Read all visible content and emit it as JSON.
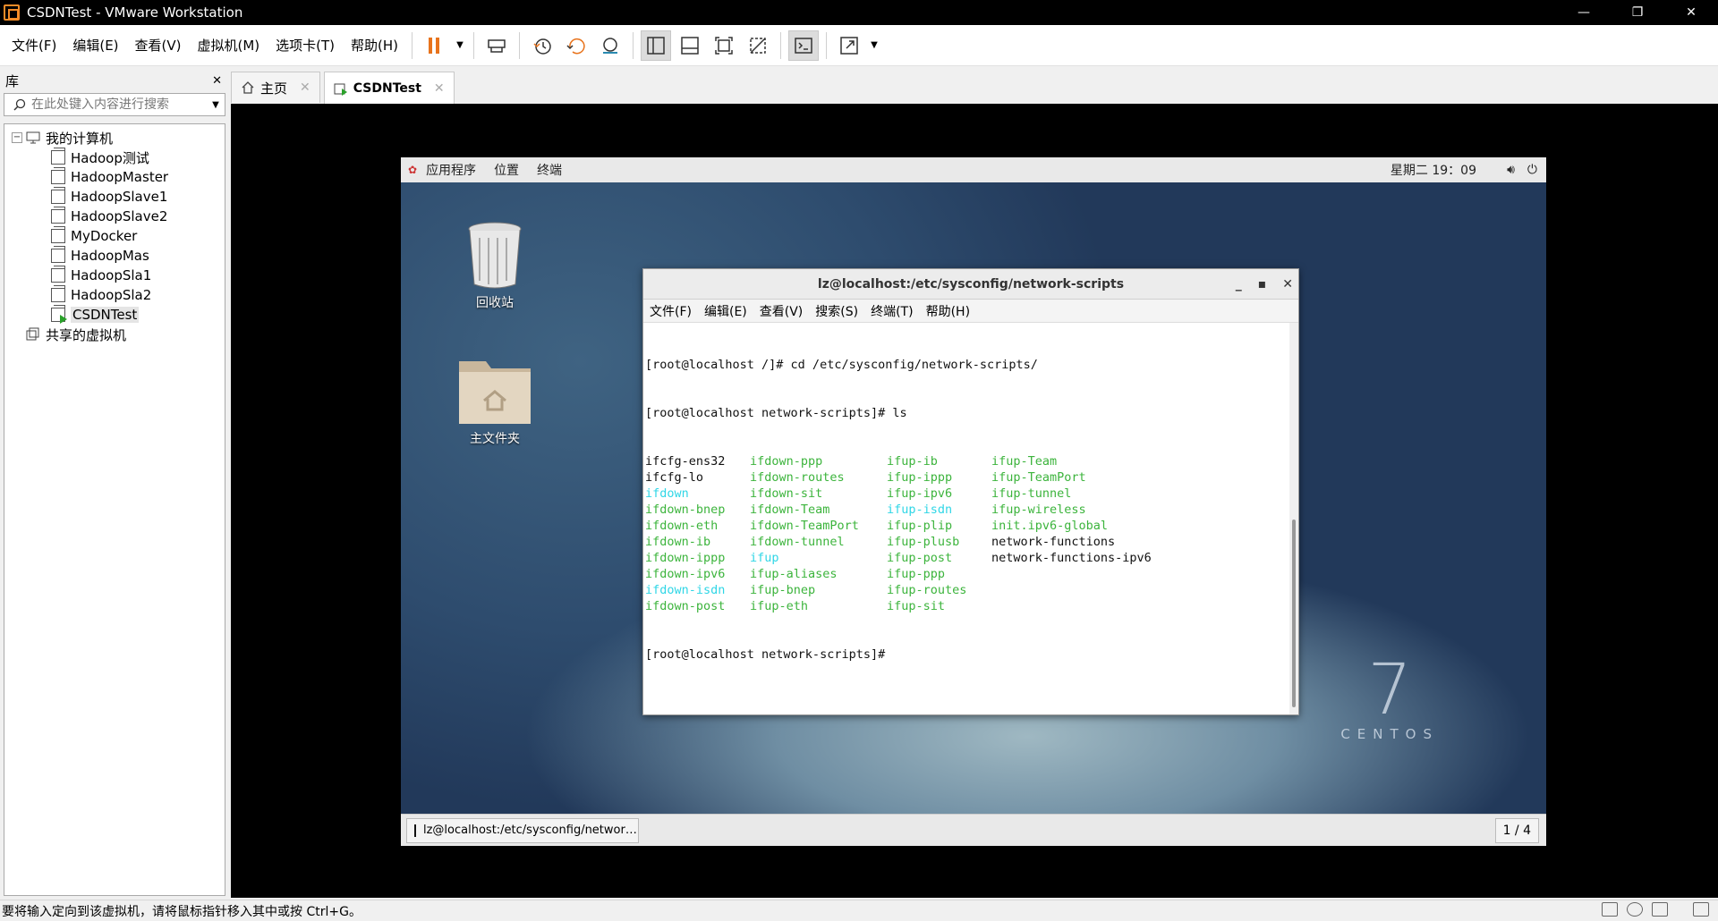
{
  "window": {
    "title": "CSDNTest - VMware Workstation",
    "minimize": "—",
    "restore": "❐",
    "close": "✕"
  },
  "menu": [
    "文件(F)",
    "编辑(E)",
    "查看(V)",
    "虚拟机(M)",
    "选项卡(T)",
    "帮助(H)"
  ],
  "library": {
    "title": "库",
    "close": "✕",
    "search_placeholder": "在此处键入内容进行搜索",
    "root": "我的计算机",
    "vms": [
      "Hadoop测试",
      "HadoopMaster",
      "HadoopSlave1",
      "HadoopSlave2",
      "MyDocker",
      "HadoopMas",
      "HadoopSla1",
      "HadoopSla2",
      "CSDNTest"
    ],
    "shared": "共享的虚拟机"
  },
  "tabs": [
    {
      "label": "主页",
      "close": "✕"
    },
    {
      "label": "CSDNTest",
      "close": "✕"
    }
  ],
  "guest": {
    "top_menu": [
      "应用程序",
      "位置",
      "终端"
    ],
    "clock": "星期二 19：09",
    "desktop_icons": [
      "回收站",
      "主文件夹"
    ],
    "logo_number": "7",
    "logo_word": "CENTOS",
    "task_label": "lz@localhost:/etc/sysconfig/networ…",
    "pager": "1 / 4"
  },
  "terminal": {
    "title": "lz@localhost:/etc/sysconfig/network-scripts",
    "menu": [
      "文件(F)",
      "编辑(E)",
      "查看(V)",
      "搜索(S)",
      "终端(T)",
      "帮助(H)"
    ],
    "line1": "[root@localhost /]# cd /etc/sysconfig/network-scripts/",
    "line2": "[root@localhost network-scripts]# ls",
    "ls_rows": [
      [
        {
          "t": "ifcfg-ens32",
          "c": "plain"
        },
        {
          "t": "ifdown-ppp",
          "c": "green"
        },
        {
          "t": "ifup-ib",
          "c": "green"
        },
        {
          "t": "ifup-Team",
          "c": "green"
        }
      ],
      [
        {
          "t": "ifcfg-lo",
          "c": "plain"
        },
        {
          "t": "ifdown-routes",
          "c": "green"
        },
        {
          "t": "ifup-ippp",
          "c": "green"
        },
        {
          "t": "ifup-TeamPort",
          "c": "green"
        }
      ],
      [
        {
          "t": "ifdown",
          "c": "cyan"
        },
        {
          "t": "ifdown-sit",
          "c": "green"
        },
        {
          "t": "ifup-ipv6",
          "c": "green"
        },
        {
          "t": "ifup-tunnel",
          "c": "green"
        }
      ],
      [
        {
          "t": "ifdown-bnep",
          "c": "green"
        },
        {
          "t": "ifdown-Team",
          "c": "green"
        },
        {
          "t": "ifup-isdn",
          "c": "cyan"
        },
        {
          "t": "ifup-wireless",
          "c": "green"
        }
      ],
      [
        {
          "t": "ifdown-eth",
          "c": "green"
        },
        {
          "t": "ifdown-TeamPort",
          "c": "green"
        },
        {
          "t": "ifup-plip",
          "c": "green"
        },
        {
          "t": "init.ipv6-global",
          "c": "green"
        }
      ],
      [
        {
          "t": "ifdown-ib",
          "c": "green"
        },
        {
          "t": "ifdown-tunnel",
          "c": "green"
        },
        {
          "t": "ifup-plusb",
          "c": "green"
        },
        {
          "t": "network-functions",
          "c": "plain"
        }
      ],
      [
        {
          "t": "ifdown-ippp",
          "c": "green"
        },
        {
          "t": "ifup",
          "c": "cyan"
        },
        {
          "t": "ifup-post",
          "c": "green"
        },
        {
          "t": "network-functions-ipv6",
          "c": "plain"
        }
      ],
      [
        {
          "t": "ifdown-ipv6",
          "c": "green"
        },
        {
          "t": "ifup-aliases",
          "c": "green"
        },
        {
          "t": "ifup-ppp",
          "c": "green"
        },
        {
          "t": "",
          "c": "plain"
        }
      ],
      [
        {
          "t": "ifdown-isdn",
          "c": "cyan"
        },
        {
          "t": "ifup-bnep",
          "c": "green"
        },
        {
          "t": "ifup-routes",
          "c": "green"
        },
        {
          "t": "",
          "c": "plain"
        }
      ],
      [
        {
          "t": "ifdown-post",
          "c": "green"
        },
        {
          "t": "ifup-eth",
          "c": "green"
        },
        {
          "t": "ifup-sit",
          "c": "green"
        },
        {
          "t": "",
          "c": "plain"
        }
      ]
    ],
    "prompt": "[root@localhost network-scripts]# "
  },
  "status": {
    "message": "要将输入定向到该虚拟机，请将鼠标指针移入其中或按 Ctrl+G。"
  },
  "colors": {
    "accent_orange": "#f28c28",
    "term_green": "#3cb43c",
    "term_cyan": "#2fd6e6"
  }
}
